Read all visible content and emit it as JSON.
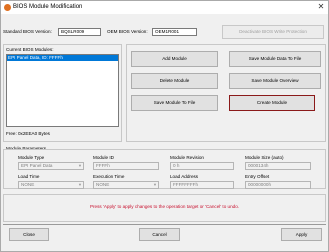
{
  "window": {
    "title": "BIOS Module Modification",
    "close_glyph": "✕"
  },
  "header": {
    "standard_label": "Standard BIOS Version:",
    "standard_value": "BQSLR009",
    "oem_label": "OEM BIOS Version:",
    "oem_value": "OEM1R001",
    "deactivate_label": "Deactivate BIOS Write Protection"
  },
  "modules": {
    "label": "Current BIOS Modules:",
    "items": [
      "EPI Panel Data, ID: FFFFh"
    ],
    "free_text": "Free: 0x2EEA0 Bytes"
  },
  "actions": {
    "add": "Add Module",
    "save_data": "Save Module Data To File",
    "delete": "Delete Module",
    "overview": "Save Module Overview",
    "save_to_file": "Save Module To File",
    "create": "Create Module"
  },
  "params": {
    "legend": "Module Parameters",
    "type_label": "Module Type",
    "type_value": "EPI Panel Data",
    "id_label": "Module ID",
    "id_value": "FFFFh",
    "rev_label": "Module Revision",
    "rev_value": "0 h",
    "size_label": "Module Size (auto)",
    "size_value": "0000134h",
    "load_time_label": "Load Time",
    "load_time_value": "NONE",
    "exec_time_label": "Execution Time",
    "exec_time_value": "NONE",
    "load_addr_label": "Load Address",
    "load_addr_value": "FFFFFFFFh",
    "entry_label": "Entry Offset",
    "entry_value": "00000000h"
  },
  "status": "Press 'Apply' to apply changes to the operation target or 'Cancel' to undo.",
  "footer": {
    "close": "Close",
    "cancel": "Cancel",
    "apply": "Apply"
  },
  "colors": {
    "status_text": "#c8102e",
    "selection": "#0078d7",
    "focus_border": "#8b1a1a"
  }
}
